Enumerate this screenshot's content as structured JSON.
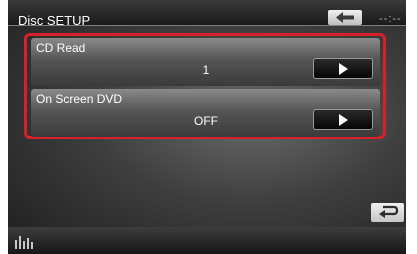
{
  "header": {
    "title": "Disc SETUP",
    "time": "--:--"
  },
  "rows": [
    {
      "label": "CD Read",
      "value": "1"
    },
    {
      "label": "On Screen DVD",
      "value": "OFF"
    }
  ],
  "icons": {
    "back": "left-arrow-icon",
    "row_arrow": "play-arrow-icon",
    "return": "return-icon",
    "equalizer": "equalizer-icon"
  },
  "colors": {
    "highlight_border": "#d8202a"
  }
}
